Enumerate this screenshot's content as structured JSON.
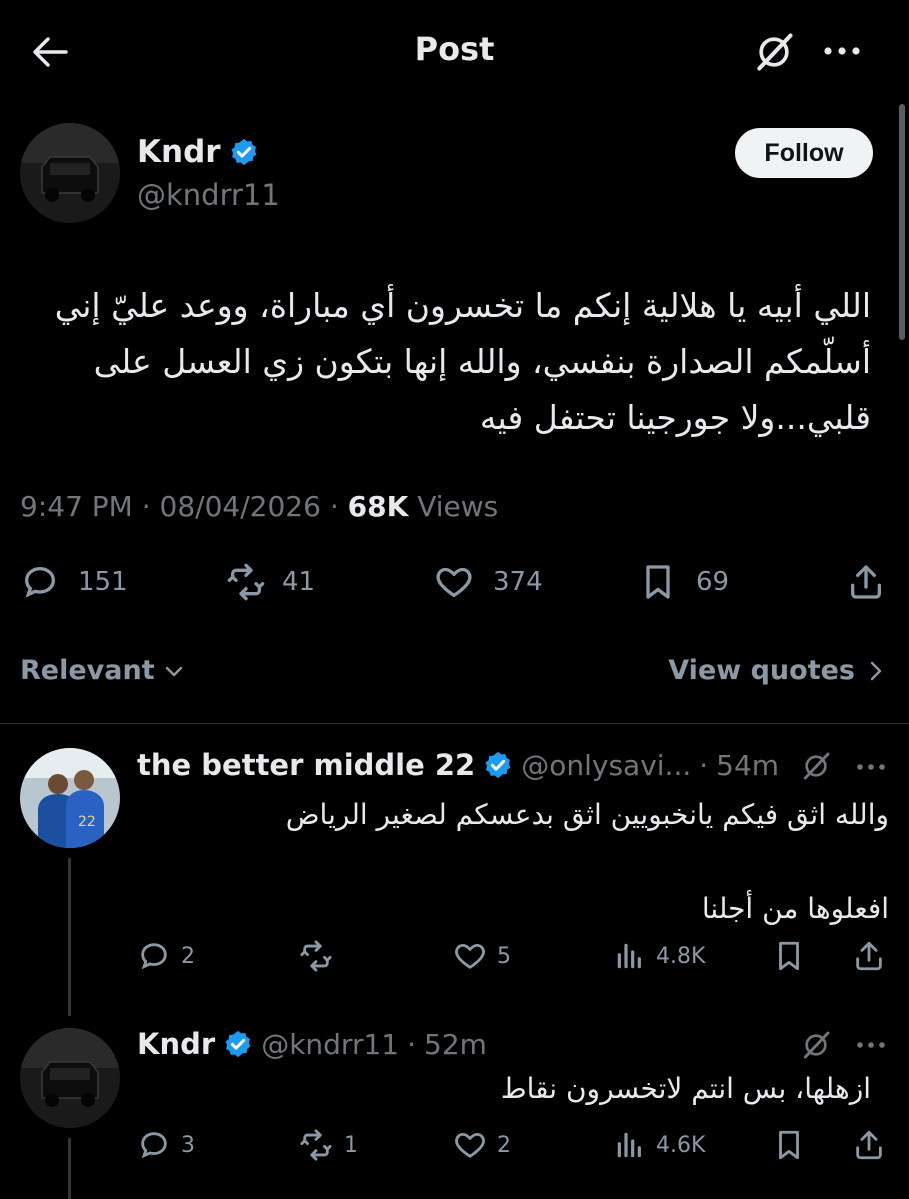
{
  "header": {
    "title": "Post"
  },
  "tweet": {
    "author_name": "Kndr",
    "handle": "@kndrr11",
    "follow_label": "Follow",
    "text_lines": [
      "اللي أبيه يا هلالية إنكم ما تخسرون أي مباراة، ووعد عليّ إني",
      "أسلّمكم الصدارة بنفسي، والله إنها بتكون زي العسل على",
      "قلبي...ولا جورجينا تحتفل فيه"
    ],
    "time": "9:47 PM",
    "date": "08/04/2026",
    "views_count": "68K",
    "views_label": "Views",
    "sep": "·",
    "stats": {
      "replies": "151",
      "reposts": "41",
      "likes": "374",
      "bookmarks": "69"
    }
  },
  "sort": {
    "label": "Relevant",
    "view_quotes": "View quotes"
  },
  "replies": [
    {
      "author_name": "the better middle 22",
      "handle": "@onlysavi...",
      "time": "54m",
      "line1": "والله اثق فيكم يانخبويين اثق بدعسكم لصغير الرياض",
      "line3": "افعلوها من أجلنا",
      "stats": {
        "replies": "2",
        "reposts": "",
        "likes": "5",
        "views": "4.8K"
      }
    },
    {
      "author_name": "Kndr",
      "handle": "@kndrr11",
      "time": "52m",
      "line1": "ازهلها، بس انتم لاتخسرون نقاط",
      "stats": {
        "replies": "3",
        "reposts": "1",
        "likes": "2",
        "views": "4.6K"
      }
    }
  ],
  "colors": {
    "verified": "#1d9bf0",
    "green_heart": "#3ec73e",
    "blue_heart": "#2f6bff"
  }
}
